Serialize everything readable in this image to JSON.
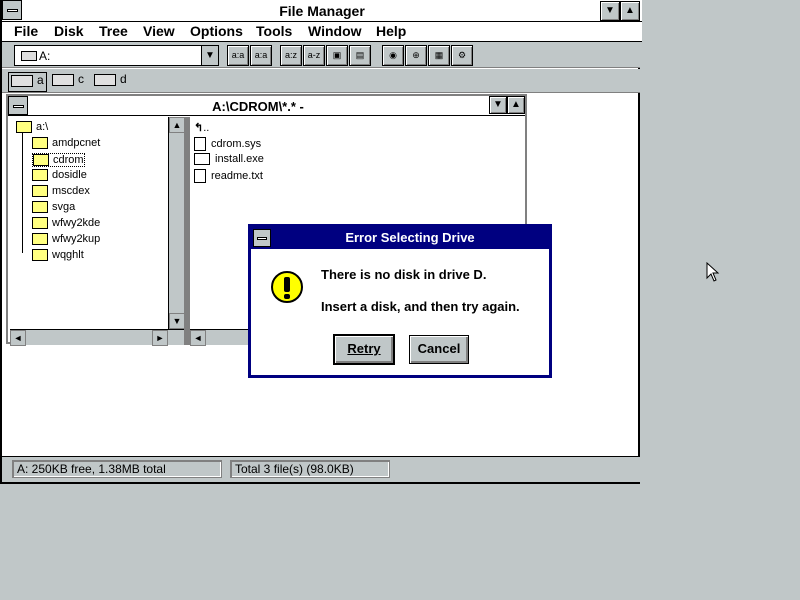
{
  "window": {
    "title": "File Manager",
    "menu": [
      "File",
      "Disk",
      "Tree",
      "View",
      "Options",
      "Tools",
      "Window",
      "Help"
    ]
  },
  "toolbar": {
    "drive_value": "A:",
    "buttons": [
      "connect-network-drive",
      "disconnect-network-drive",
      "share-as",
      "stop-sharing",
      "view-by-name",
      "view-all-details",
      "view-partial-details",
      "view-by-file-type",
      "copy-disk",
      "move",
      "search",
      "properties",
      "hidden"
    ]
  },
  "drivebar": {
    "drives": [
      "a",
      "c",
      "d"
    ]
  },
  "child": {
    "title": "A:\\CDROM\\*.* -"
  },
  "tree": {
    "root": "a:\\",
    "items": [
      "amdpcnet",
      "cdrom",
      "dosidle",
      "mscdex",
      "svga",
      "wfwy2kde",
      "wfwy2kup",
      "wqghlt"
    ]
  },
  "files": {
    "items": [
      "..",
      "cdrom.sys",
      "install.exe",
      "readme.txt"
    ]
  },
  "status": {
    "left": "A: 250KB free,  1.38MB total",
    "right": "Total 3 file(s) (98.0KB)"
  },
  "dialog": {
    "title": "Error Selecting Drive",
    "line1": "There is no disk in drive D.",
    "line2": "Insert a disk, and then try again.",
    "retry": "Retry",
    "cancel": "Cancel"
  }
}
